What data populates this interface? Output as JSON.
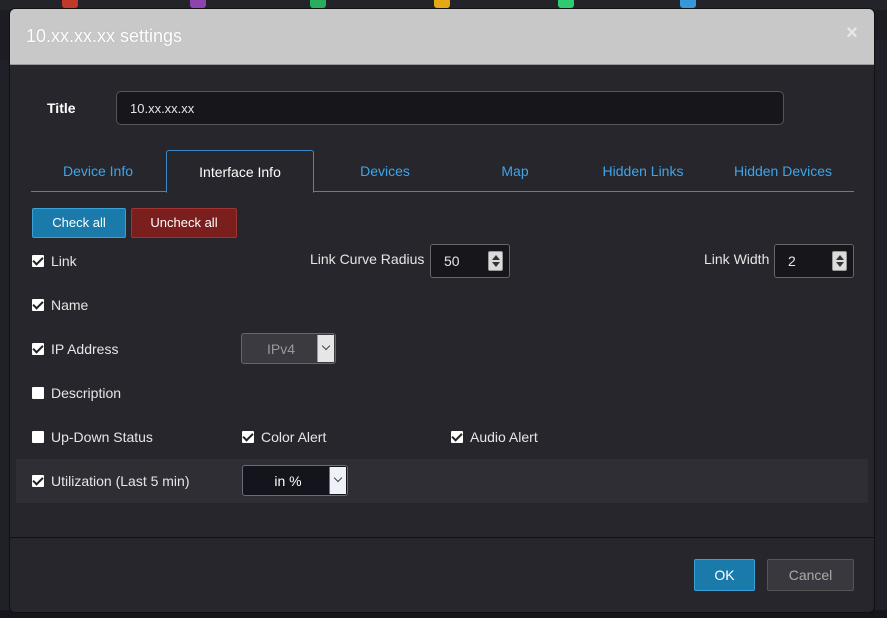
{
  "modal": {
    "title": "10.xx.xx.xx settings",
    "close_glyph": "×",
    "title_field": {
      "label": "Title",
      "value": "10.xx.xx.xx"
    }
  },
  "tabs": [
    {
      "label": "Device Info",
      "active": false
    },
    {
      "label": "Interface Info",
      "active": true
    },
    {
      "label": "Devices",
      "active": false
    },
    {
      "label": "Map",
      "active": false
    },
    {
      "label": "Hidden Links",
      "active": false
    },
    {
      "label": "Hidden Devices",
      "active": false
    }
  ],
  "actions": {
    "check_all": "Check all",
    "uncheck_all": "Uncheck all"
  },
  "options": {
    "link": {
      "label": "Link",
      "checked": true
    },
    "name": {
      "label": "Name",
      "checked": true
    },
    "ip_address": {
      "label": "IP Address",
      "checked": true
    },
    "description": {
      "label": "Description",
      "checked": false
    },
    "up_down_status": {
      "label": "Up-Down Status",
      "checked": false
    },
    "color_alert": {
      "label": "Color Alert",
      "checked": true
    },
    "audio_alert": {
      "label": "Audio Alert",
      "checked": true
    },
    "utilization": {
      "label": "Utilization (Last 5 min)",
      "checked": true
    }
  },
  "link_curve_radius": {
    "label": "Link Curve Radius",
    "value": "50"
  },
  "link_width": {
    "label": "Link Width",
    "value": "2"
  },
  "ip_version_select": {
    "value": "IPv4"
  },
  "utilization_unit_select": {
    "value": "in %"
  },
  "footer": {
    "ok": "OK",
    "cancel": "Cancel"
  },
  "colors": {
    "accent": "#1a7bab",
    "danger": "#7a1e1e",
    "tab_text": "#3fa5e8"
  }
}
